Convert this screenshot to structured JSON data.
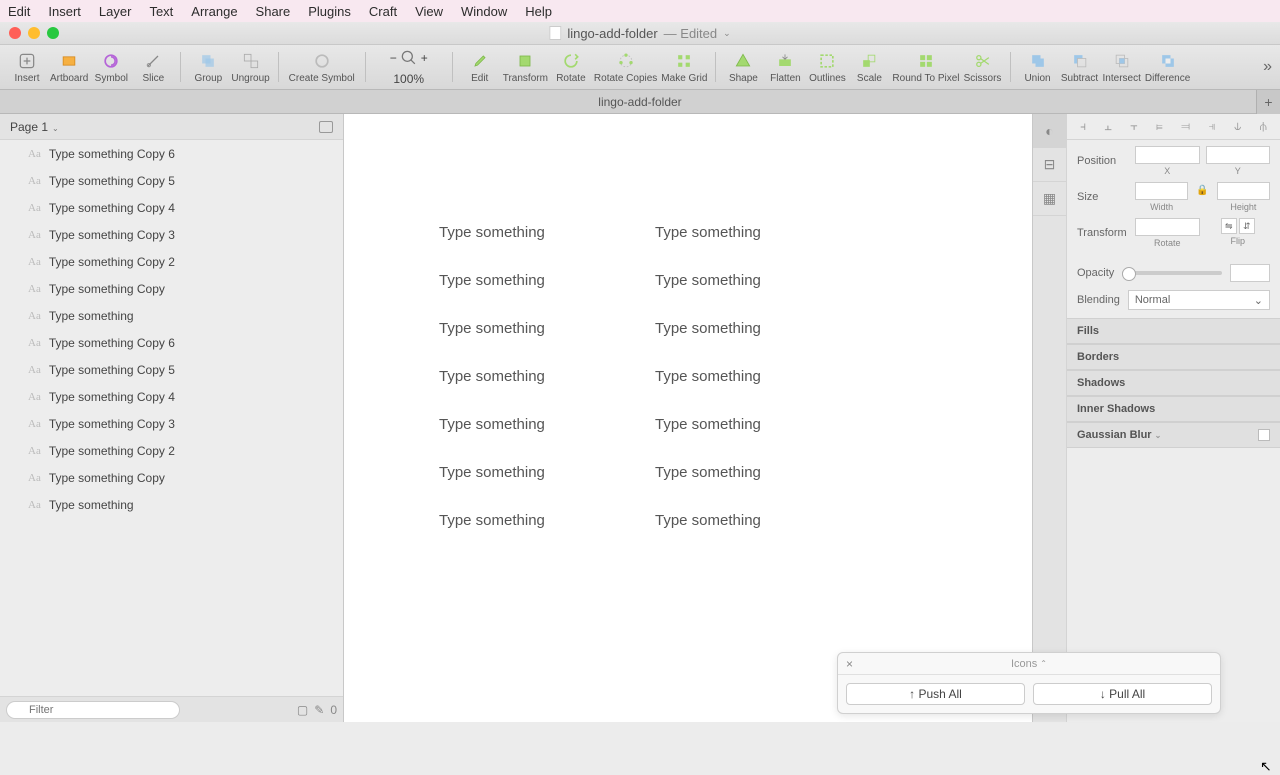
{
  "menubar": [
    "Edit",
    "Insert",
    "Layer",
    "Text",
    "Arrange",
    "Share",
    "Plugins",
    "Craft",
    "View",
    "Window",
    "Help"
  ],
  "document": {
    "name": "lingo-add-folder",
    "status": "— Edited"
  },
  "toolbar": {
    "insert": "Insert",
    "artboard": "Artboard",
    "symbol": "Symbol",
    "slice": "Slice",
    "group": "Group",
    "ungroup": "Ungroup",
    "create_symbol": "Create Symbol",
    "zoom": "100%",
    "edit": "Edit",
    "transform": "Transform",
    "rotate": "Rotate",
    "rotate_copies": "Rotate Copies",
    "make_grid": "Make Grid",
    "shape": "Shape",
    "flatten": "Flatten",
    "outlines": "Outlines",
    "scale": "Scale",
    "round": "Round To Pixel",
    "scissors": "Scissors",
    "union": "Union",
    "subtract": "Subtract",
    "intersect": "Intersect",
    "difference": "Difference"
  },
  "tab": "lingo-add-folder",
  "page_label": "Page 1",
  "layers": [
    "Type something Copy 6",
    "Type something Copy 5",
    "Type something Copy 4",
    "Type something Copy 3",
    "Type something Copy 2",
    "Type something Copy",
    "Type something",
    "Type something Copy 6",
    "Type something Copy 5",
    "Type something Copy 4",
    "Type something Copy 3",
    "Type something Copy 2",
    "Type something Copy",
    "Type something"
  ],
  "filter_placeholder": "Filter",
  "filter_count": "0",
  "canvas_text": "Type something",
  "popup": {
    "title": "Icons",
    "push": "Push All",
    "pull": "Pull All"
  },
  "inspector": {
    "position": "Position",
    "x": "X",
    "y": "Y",
    "size": "Size",
    "width": "Width",
    "height": "Height",
    "transform": "Transform",
    "rotate": "Rotate",
    "flip": "Flip",
    "opacity": "Opacity",
    "blending": "Blending",
    "blend_mode": "Normal",
    "fills": "Fills",
    "borders": "Borders",
    "shadows": "Shadows",
    "inner_shadows": "Inner Shadows",
    "gaussian_blur": "Gaussian Blur"
  }
}
